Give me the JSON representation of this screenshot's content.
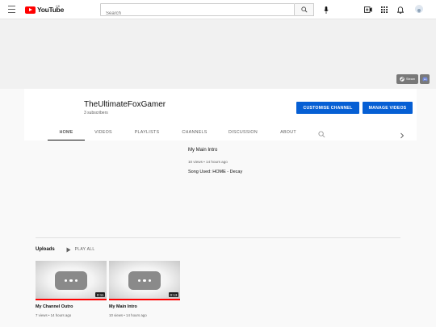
{
  "header": {
    "logo_text": "YouTube",
    "region": "GB",
    "search_placeholder": "Search",
    "icons": [
      "menu-icon",
      "search-icon",
      "mic-icon",
      "create-video-icon",
      "apps-icon",
      "bell-icon",
      "avatar"
    ]
  },
  "banner": {
    "links": [
      {
        "label": "Steam",
        "icon": "steam-icon"
      },
      {
        "label": "",
        "icon": "discord-icon"
      }
    ]
  },
  "channel": {
    "name": "TheUltimateFoxGamer",
    "subscribers": "3 subscribers",
    "customise_label": "CUSTOMISE CHANNEL",
    "manage_label": "MANAGE VIDEOS",
    "button_color": "#065fd4"
  },
  "tabs": [
    {
      "label": "HOME",
      "active": true
    },
    {
      "label": "VIDEOS",
      "active": false
    },
    {
      "label": "PLAYLISTS",
      "active": false
    },
    {
      "label": "CHANNELS",
      "active": false
    },
    {
      "label": "DISCUSSION",
      "active": false
    },
    {
      "label": "ABOUT",
      "active": false
    }
  ],
  "featured": {
    "title": "My Main Intro",
    "meta": "10 views • 14 hours ago",
    "description": "Song Used: HOME - Decay"
  },
  "uploads": {
    "title": "Uploads",
    "play_all_label": "PLAY ALL",
    "videos": [
      {
        "title": "My Channel Outro",
        "meta": "7 views • 14 hours ago",
        "duration": "0:11",
        "watched_fraction": 1.0
      },
      {
        "title": "My Main Intro",
        "meta": "10 views • 14 hours ago",
        "duration": "0:13",
        "watched_fraction": 1.0
      }
    ]
  },
  "colors": {
    "brand_red": "#ff0000",
    "accent_blue": "#065fd4"
  }
}
